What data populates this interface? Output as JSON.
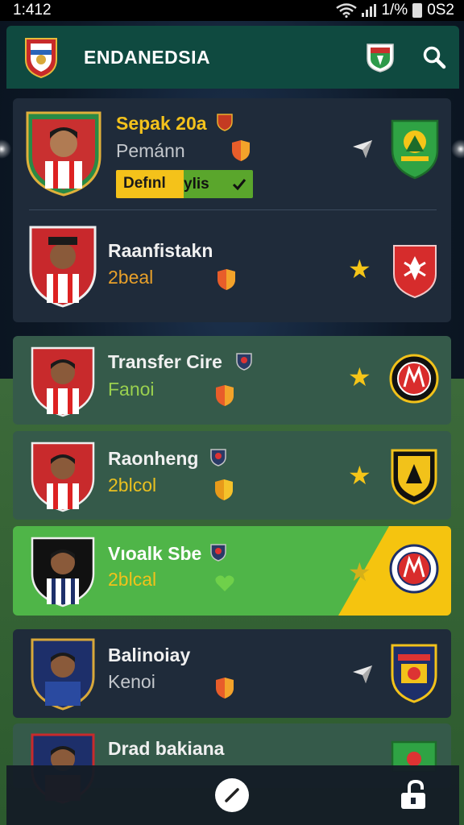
{
  "status_bar": {
    "time": "1:412",
    "battery_text": "1/%",
    "right_text": "0S2"
  },
  "header": {
    "title": "ENDANEDSIA"
  },
  "players": [
    {
      "name": "Sepak 20a",
      "subtitle": "Pemánn",
      "pill_left": "Defınl",
      "pill_right": "ylis"
    },
    {
      "name": "Raanfistakn",
      "subtitle": "2beal"
    },
    {
      "name": "Transfer Cire",
      "subtitle": "Fanoi"
    },
    {
      "name": "Raonheng",
      "subtitle": "2blcol"
    },
    {
      "name": "Vıoalk Sbe",
      "subtitle": "2blcal"
    },
    {
      "name": "Balinoiay",
      "subtitle": "Kenoi"
    },
    {
      "name": "Drad bakiana",
      "subtitle": ""
    }
  ],
  "colors": {
    "header_bg": "#0f4a40",
    "accent_yellow": "#f5c518",
    "accent_green": "#4fb548"
  },
  "icons": [
    "search-icon",
    "star-icon",
    "shield-icon",
    "nav-arrow-icon",
    "edit-icon",
    "lock-icon"
  ]
}
